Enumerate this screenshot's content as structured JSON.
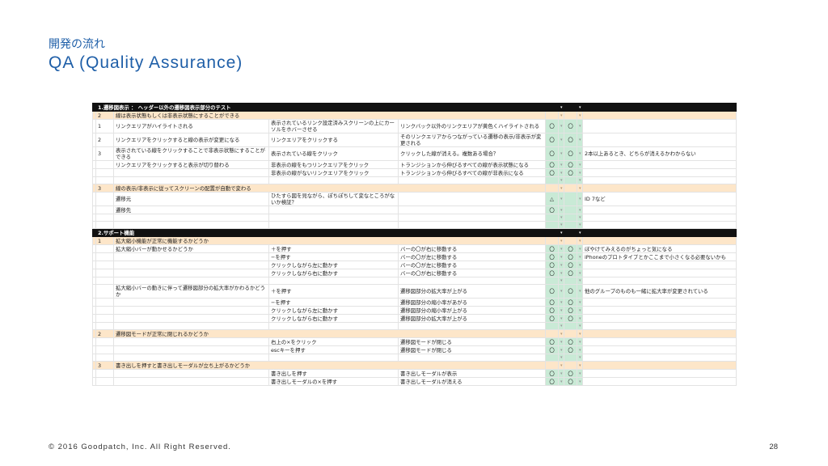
{
  "slide": {
    "kicker": "開発の流れ",
    "title": "QA (Quality Assurance)",
    "footer": "© 2016 Goodpatch, Inc. All Right Reserved.",
    "page_number": "28"
  },
  "colors": {
    "accent": "#1f5fa8",
    "header_bg": "#111111",
    "section_bg": "#fde6c9",
    "ok_bg": "#c9ead6"
  },
  "sheet": {
    "rows": [
      {
        "type": "hdr",
        "a": "1.遷移図表示 ： ヘッダー以外の遷移図表示部分のテスト",
        "b": "",
        "c": "",
        "d": "",
        "e": "",
        "f": "",
        "g": ""
      },
      {
        "type": "sec",
        "a": "2",
        "b": "線は表示状態もしくは非表示状態にすることができる",
        "c": "",
        "d": "",
        "e": "",
        "f": "",
        "g": ""
      },
      {
        "type": "tall",
        "a": "1",
        "b": "リンクエリアがハイライトされる",
        "c": "表示されているリンク設定済みスクリーンの上にカーソルをホバーさせる",
        "d": "リンクバック以外のリンクエリアが黄色くハイライトされる",
        "e": "〇",
        "f": "〇",
        "g": ""
      },
      {
        "type": "tall",
        "a": "2",
        "b": "リンクエリアをクリックすると線の表示が変更になる",
        "c": "リンクエリアをクリックする",
        "d": "そのリンクエリアからつながっている遷移の表示/非表示が変更される",
        "e": "〇",
        "f": "〇",
        "g": ""
      },
      {
        "type": "tall",
        "a": "3",
        "b": "表示されている線をクリックすることで非表示状態にすることができる",
        "c": "表示されている線をクリック",
        "d": "クリックした線が消える。複数ある場合？",
        "e": "〇",
        "f": "〇",
        "g": "2本以上あるとき、どちらが消えるかわからない"
      },
      {
        "type": "row",
        "a": "",
        "b": "リンクエリアをクリックすると表示が切り替わる",
        "c": "非表示の線をもつリンクエリアをクリック",
        "d": "トランジションから伸びるすべての線が表示状態になる",
        "e": "〇",
        "f": "〇",
        "g": ""
      },
      {
        "type": "row",
        "a": "",
        "b": "",
        "c": "非表示の線がないリンクエリアをクリック",
        "d": "トランジションから伸びるすべての線が非表示になる",
        "e": "〇",
        "f": "〇",
        "g": ""
      },
      {
        "type": "blank",
        "a": "",
        "b": "",
        "c": "",
        "d": "",
        "e": "",
        "f": "",
        "g": ""
      },
      {
        "type": "sec",
        "a": "3",
        "b": "線の表示/非表示に従ってスクリーンの配置が自動で変わる",
        "c": "",
        "d": "",
        "e": "",
        "f": "",
        "g": ""
      },
      {
        "type": "tall",
        "a": "",
        "b": "遷移元",
        "c": "ひたすら図を見ながら、ぽちぽちして変なところがないか検証？",
        "d": "",
        "e": "△",
        "f": "",
        "g": "ID 7など"
      },
      {
        "type": "row",
        "a": "",
        "b": "遷移先",
        "c": "",
        "d": "",
        "e": "〇",
        "f": "",
        "g": ""
      },
      {
        "type": "blank",
        "a": "",
        "b": "",
        "c": "",
        "d": "",
        "e": "",
        "f": "",
        "g": ""
      },
      {
        "type": "blank",
        "a": "",
        "b": "",
        "c": "",
        "d": "",
        "e": "",
        "f": "",
        "g": ""
      },
      {
        "type": "hdr",
        "a": "2.サポート機能",
        "b": "",
        "c": "",
        "d": "",
        "e": "",
        "f": "",
        "g": ""
      },
      {
        "type": "sec",
        "a": "1",
        "b": "拡大縮小機能が正常に機能するかどうか",
        "c": "",
        "d": "",
        "e": "",
        "f": "",
        "g": ""
      },
      {
        "type": "row",
        "a": "",
        "b": "拡大縮小バーが動かせるかどうか",
        "c": "＋を押す",
        "d": "バーの〇が右に移動する",
        "e": "〇",
        "f": "〇",
        "g": "ぼやけてみえるのがちょっと気になる"
      },
      {
        "type": "row",
        "a": "",
        "b": "",
        "c": "−を押す",
        "d": "バーの〇が左に移動する",
        "e": "〇",
        "f": "〇",
        "g": "iPhoneのプロトタイプとかここまで小さくなる必要ないかも"
      },
      {
        "type": "row",
        "a": "",
        "b": "",
        "c": "クリックしながら左に動かす",
        "d": "バーの〇が左に移動する",
        "e": "〇",
        "f": "〇",
        "g": ""
      },
      {
        "type": "row",
        "a": "",
        "b": "",
        "c": "クリックしながら右に動かす",
        "d": "バーの〇が右に移動する",
        "e": "〇",
        "f": "〇",
        "g": ""
      },
      {
        "type": "blank",
        "a": "",
        "b": "",
        "c": "",
        "d": "",
        "e": "",
        "f": "",
        "g": ""
      },
      {
        "type": "tall",
        "a": "",
        "b": "拡大縮小バーの動きに伴って遷移図部分の拡大率がかわるかどうか",
        "c": "＋を押す",
        "d": "遷移図部分の拡大率が上がる",
        "e": "〇",
        "f": "〇",
        "g": "他のグループのものも一緒に拡大率が変更されている"
      },
      {
        "type": "row",
        "a": "",
        "b": "",
        "c": "−を押す",
        "d": "遷移図部分の縮小率があがる",
        "e": "〇",
        "f": "〇",
        "g": ""
      },
      {
        "type": "row",
        "a": "",
        "b": "",
        "c": "クリックしながら左に動かす",
        "d": "遷移図部分の縮小率が上がる",
        "e": "〇",
        "f": "〇",
        "g": ""
      },
      {
        "type": "row",
        "a": "",
        "b": "",
        "c": "クリックしながら右に動かす",
        "d": "遷移図部分の拡大率が上がる",
        "e": "〇",
        "f": "〇",
        "g": ""
      },
      {
        "type": "blank",
        "a": "",
        "b": "",
        "c": "",
        "d": "",
        "e": "",
        "f": "",
        "g": ""
      },
      {
        "type": "sec",
        "a": "2",
        "b": "遷移図モードが正常に閉じれるかどうか",
        "c": "",
        "d": "",
        "e": "",
        "f": "",
        "g": ""
      },
      {
        "type": "row",
        "a": "",
        "b": "",
        "c": "右上の×をクリック",
        "d": "遷移図モードが閉じる",
        "e": "〇",
        "f": "〇",
        "g": ""
      },
      {
        "type": "row",
        "a": "",
        "b": "",
        "c": "escキーを押す",
        "d": "遷移図モードが閉じる",
        "e": "〇",
        "f": "〇",
        "g": ""
      },
      {
        "type": "blank",
        "a": "",
        "b": "",
        "c": "",
        "d": "",
        "e": "",
        "f": "",
        "g": ""
      },
      {
        "type": "sec",
        "a": "3",
        "b": "書き出しを押すと書き出しモーダルが立ち上がるかどうか",
        "c": "",
        "d": "",
        "e": "",
        "f": "",
        "g": ""
      },
      {
        "type": "row",
        "a": "",
        "b": "",
        "c": "書き出しを押す",
        "d": "書き出しモーダルが表示",
        "e": "〇",
        "f": "〇",
        "g": ""
      },
      {
        "type": "row",
        "a": "",
        "b": "",
        "c": "書き出しモーダルの×を押す",
        "d": "書き出しモーダルが消える",
        "e": "〇",
        "f": "〇",
        "g": ""
      }
    ]
  }
}
